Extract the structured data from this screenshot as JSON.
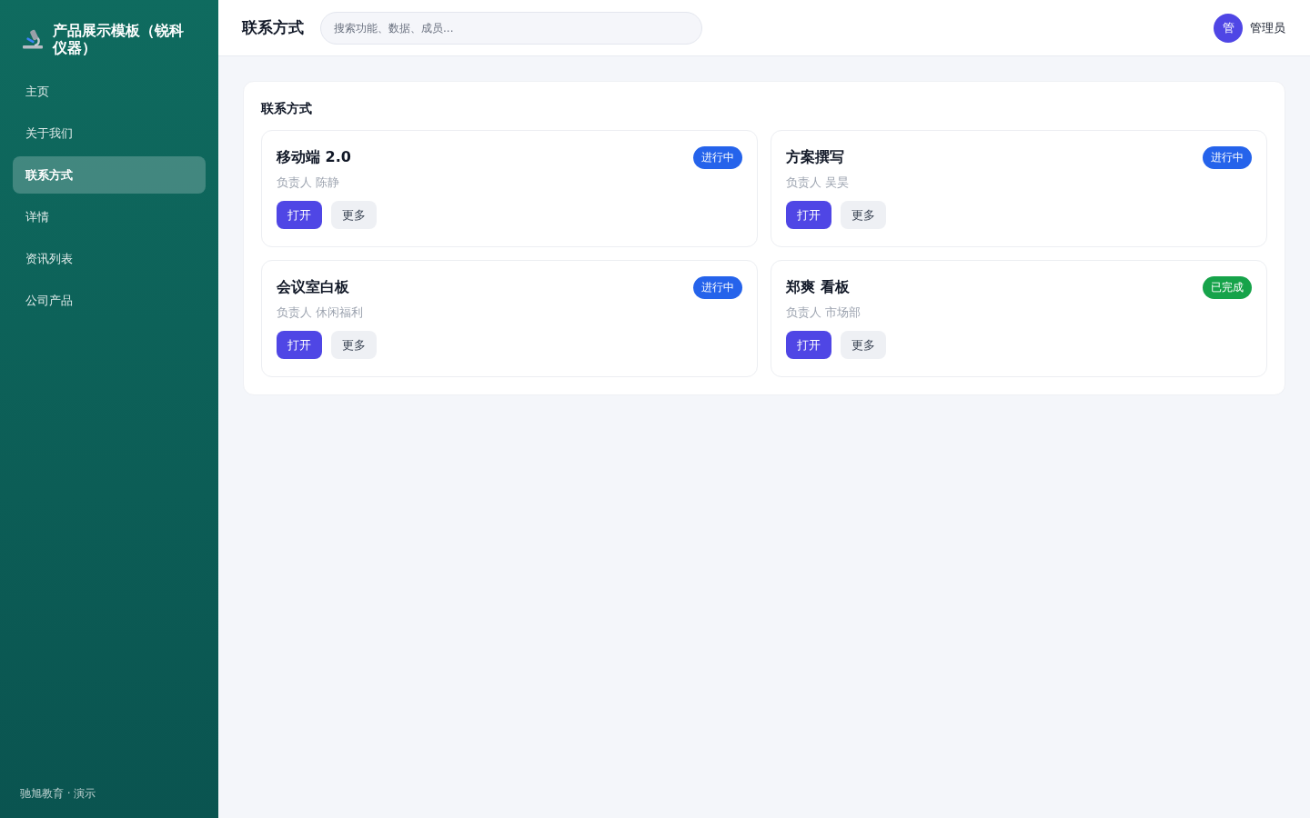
{
  "sidebar": {
    "brand": "产品展示模板（锐科仪器）",
    "items": [
      {
        "label": "主页",
        "selected": false
      },
      {
        "label": "关于我们",
        "selected": false
      },
      {
        "label": "联系方式",
        "selected": true
      },
      {
        "label": "详情",
        "selected": false
      },
      {
        "label": "资讯列表",
        "selected": false
      },
      {
        "label": "公司产品",
        "selected": false
      }
    ],
    "footer": "驰旭教育 · 演示"
  },
  "header": {
    "title": "联系方式",
    "search": {
      "placeholder": "搜索功能、数据、成员..."
    },
    "user": {
      "avatar": "管",
      "name": "管理员"
    }
  },
  "panel": {
    "title": "联系方式",
    "cards": [
      {
        "title": "移动端 2.0",
        "owner": "负责人 陈静",
        "status": "进行中",
        "color": "#2563eb",
        "buttons": [
          {
            "label": "打开",
            "kind": "primary"
          },
          {
            "label": "更多",
            "kind": "secondary"
          }
        ]
      },
      {
        "title": "方案撰写",
        "owner": "负责人 吴昊",
        "status": "进行中",
        "color": "#2563eb",
        "buttons": [
          {
            "label": "打开",
            "kind": "primary"
          },
          {
            "label": "更多",
            "kind": "secondary"
          }
        ]
      },
      {
        "title": "会议室白板",
        "owner": "负责人 休闲福利",
        "status": "进行中",
        "color": "#2563eb",
        "buttons": [
          {
            "label": "打开",
            "kind": "primary"
          },
          {
            "label": "更多",
            "kind": "secondary"
          }
        ]
      },
      {
        "title": "郑爽 看板",
        "owner": "负责人 市场部",
        "status": "已完成",
        "color": "#16a34a",
        "buttons": [
          {
            "label": "打开",
            "kind": "primary"
          },
          {
            "label": "更多",
            "kind": "secondary"
          }
        ]
      }
    ]
  }
}
